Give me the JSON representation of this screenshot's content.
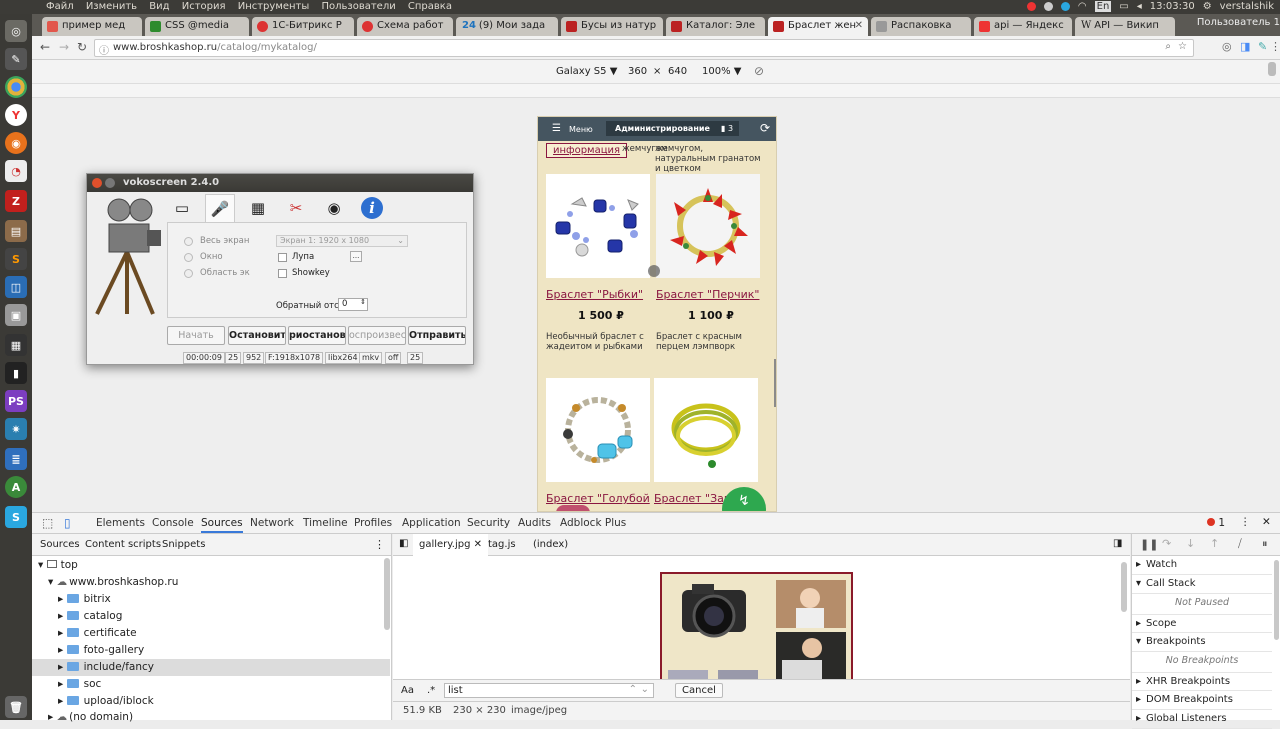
{
  "topbar": {
    "menu": [
      "Файл",
      "Изменить",
      "Вид",
      "История",
      "Инструменты",
      "Пользователи",
      "Справка"
    ],
    "lang": "En",
    "time": "13:03:30",
    "user": "verstalshik"
  },
  "browser": {
    "tabs": [
      {
        "label": "пример мед",
        "color": "#e2574c"
      },
      {
        "label": "CSS @media",
        "color": "#2e8b2e"
      },
      {
        "label": "1С-Битрикс Р",
        "color": "#d33"
      },
      {
        "label": "Схема работ",
        "color": "#d33"
      },
      {
        "label": "(9) Мои зада",
        "color": "#1e73be",
        "prefix": "24"
      },
      {
        "label": "Бусы из натур",
        "color": "#b22"
      },
      {
        "label": "Каталог: Эле",
        "color": "#b22"
      },
      {
        "label": "Браслет жен",
        "color": "#b22",
        "active": true
      },
      {
        "label": "Распаковка",
        "color": "#999"
      },
      {
        "label": "api — Яндекс",
        "color": "#e33"
      },
      {
        "label": "API — Викип",
        "color": "#777",
        "prefix": "W"
      }
    ],
    "profile": "Пользователь 1",
    "url_host": "www.broshkashop.ru",
    "url_path": "/catalog/mykatalog/"
  },
  "device": {
    "name": "Galaxy S5",
    "width": "360",
    "times": "×",
    "height": "640",
    "zoom": "100%"
  },
  "mobile": {
    "menu": "Меню",
    "admin": "Администрирование",
    "count": "3",
    "info_btn": "информация",
    "top_text1": "жемчугом",
    "top_text2": "жемчугом, натуральным гранатом и цветком",
    "products": [
      {
        "title": "Браслет \"Рыбки\"",
        "price": "1 500 ₽",
        "desc": "Необычный браслет с жадеитом и рыбками"
      },
      {
        "title": "Браслет \"Перчик\"",
        "price": "1 100 ₽",
        "desc": "Браслет с красным перцем лэмпворк"
      },
      {
        "title": "Браслет \"Голубой",
        "price": "",
        "desc": ""
      },
      {
        "title": "Браслет \"Зап",
        "price": "",
        "desc": ""
      }
    ]
  },
  "voko": {
    "title": "vokoscreen 2.4.0",
    "opt_screen": "Весь экран",
    "opt_window": "Окно",
    "opt_area": "Область эк",
    "screen_select": "Экран 1:  1920 x 1080",
    "magnifier": "Лупа",
    "showkey": "Showkey",
    "dots": "...",
    "countdown_label": "Обратный отс",
    "countdown": "0",
    "btn_start": "Начать",
    "btn_stop": "Остановить",
    "btn_pause": "риостановит",
    "btn_play": "оспроизвест",
    "btn_send": "Отправить",
    "status": [
      "00:00:09",
      "25",
      "952",
      "F:1918x1078",
      "libx264",
      "mkv",
      "off",
      "25"
    ]
  },
  "devtools": {
    "tabs": [
      "Elements",
      "Console",
      "Sources",
      "Network",
      "Timeline",
      "Profiles",
      "Application",
      "Security",
      "Audits",
      "Adblock Plus"
    ],
    "errors": "1",
    "left_tabs": [
      "Sources",
      "Content scripts",
      "Snippets"
    ],
    "tree": [
      {
        "label": "top",
        "level": 0,
        "type": "frame"
      },
      {
        "label": "www.broshkashop.ru",
        "level": 1,
        "type": "cloud"
      },
      {
        "label": "bitrix",
        "level": 2,
        "type": "folder"
      },
      {
        "label": "catalog",
        "level": 2,
        "type": "folder"
      },
      {
        "label": "certificate",
        "level": 2,
        "type": "folder"
      },
      {
        "label": "foto-gallery",
        "level": 2,
        "type": "folder"
      },
      {
        "label": "include/fancy",
        "level": 2,
        "type": "folder",
        "selected": true
      },
      {
        "label": "soc",
        "level": 2,
        "type": "folder"
      },
      {
        "label": "upload/iblock",
        "level": 2,
        "type": "folder"
      },
      {
        "label": "(no domain)",
        "level": 1,
        "type": "cloud"
      }
    ],
    "files": [
      "gallery.jpg",
      "tag.js",
      "(index)"
    ],
    "search_aa": "Aa",
    "search_regex": ".*",
    "search_value": "list",
    "cancel": "Cancel",
    "file_size": "51.9 KB",
    "dims": "230 × 230",
    "mime": "image/jpeg",
    "right": {
      "watch": "Watch",
      "call_stack": "Call Stack",
      "not_paused": "Not Paused",
      "scope": "Scope",
      "breakpoints": "Breakpoints",
      "no_breakpoints": "No Breakpoints",
      "xhr": "XHR Breakpoints",
      "dom": "DOM Breakpoints",
      "global": "Global Listeners"
    }
  }
}
